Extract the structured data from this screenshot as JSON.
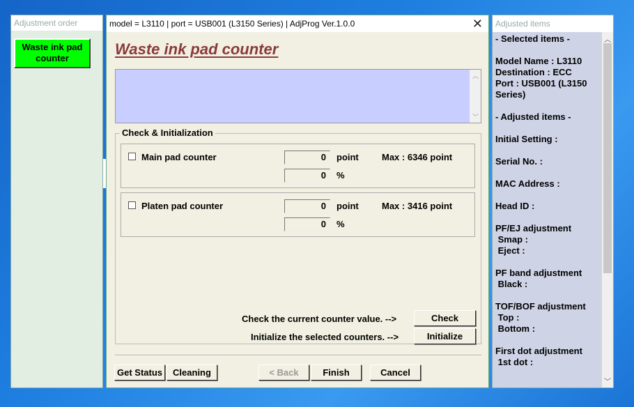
{
  "left_window": {
    "title": "Adjustment order",
    "button": "Waste ink pad counter"
  },
  "main_window": {
    "title": "model = L3110 | port = USB001 (L3150 Series) | AdjProg Ver.1.0.0",
    "heading": "Waste ink pad counter",
    "group_label": "Check & Initialization",
    "counters": [
      {
        "label": "Main pad counter",
        "point_value": "0",
        "point_unit": "point",
        "max": "Max : 6346 point",
        "percent_value": "0",
        "percent_unit": "%"
      },
      {
        "label": "Platen pad counter",
        "point_value": "0",
        "point_unit": "point",
        "max": "Max : 3416 point",
        "percent_value": "0",
        "percent_unit": "%"
      }
    ],
    "check_text": "Check the current counter value. -->",
    "check_button": "Check",
    "init_text": "Initialize the selected counters. -->",
    "init_button": "Initialize",
    "footer": {
      "get_status": "Get Status",
      "cleaning": "Cleaning",
      "back": "< Back",
      "finish": "Finish",
      "cancel": "Cancel"
    }
  },
  "right_window": {
    "title": "Adjusted items",
    "lines": [
      "- Selected items -",
      "",
      "Model Name : L3110",
      "Destination : ECC",
      "Port : USB001 (L3150 Series)",
      "",
      "- Adjusted items -",
      "",
      "Initial Setting :",
      "",
      "Serial No. :",
      "",
      "MAC Address :",
      "",
      "Head ID :",
      "",
      "PF/EJ adjustment",
      " Smap :",
      " Eject :",
      "",
      "PF band adjustment",
      " Black :",
      "",
      "TOF/BOF adjustment",
      " Top :",
      " Bottom :",
      "",
      "First dot adjustment",
      " 1st dot :"
    ]
  }
}
